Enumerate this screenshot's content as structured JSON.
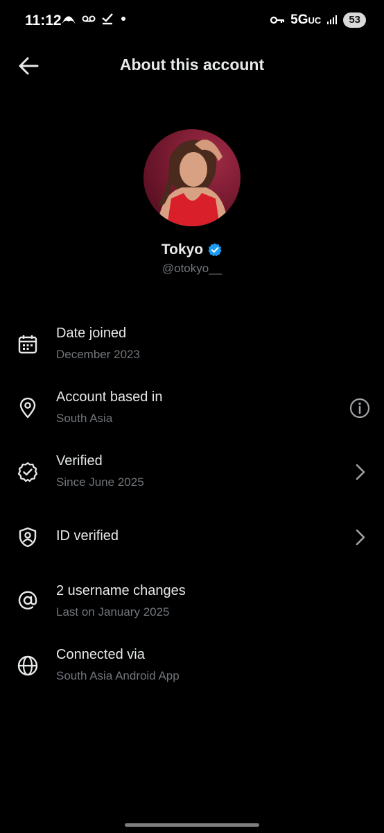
{
  "status_bar": {
    "time": "11:12",
    "network": "5G",
    "network_suffix": "UC",
    "battery": "53"
  },
  "header": {
    "title": "About this account"
  },
  "profile": {
    "display_name": "Tokyo",
    "handle": "@otokyo__"
  },
  "rows": [
    {
      "title": "Date joined",
      "subtitle": "December 2023",
      "icon": "calendar-icon"
    },
    {
      "title": "Account based in",
      "subtitle": "South Asia",
      "icon": "location-pin-icon",
      "trailing": "info-icon"
    },
    {
      "title": "Verified",
      "subtitle": "Since June 2025",
      "icon": "verified-badge-icon",
      "trailing": "chevron-right-icon"
    },
    {
      "title": "ID verified",
      "icon": "shield-user-icon",
      "trailing": "chevron-right-icon"
    },
    {
      "title": "2 username changes",
      "subtitle": "Last on January 2025",
      "icon": "at-sign-icon"
    },
    {
      "title": "Connected via",
      "subtitle": "South Asia Android App",
      "icon": "globe-icon"
    }
  ],
  "colors": {
    "background": "#000000",
    "primary_text": "#e7e9ea",
    "secondary_text": "#71767b",
    "verified_blue": "#1d9bf0"
  }
}
